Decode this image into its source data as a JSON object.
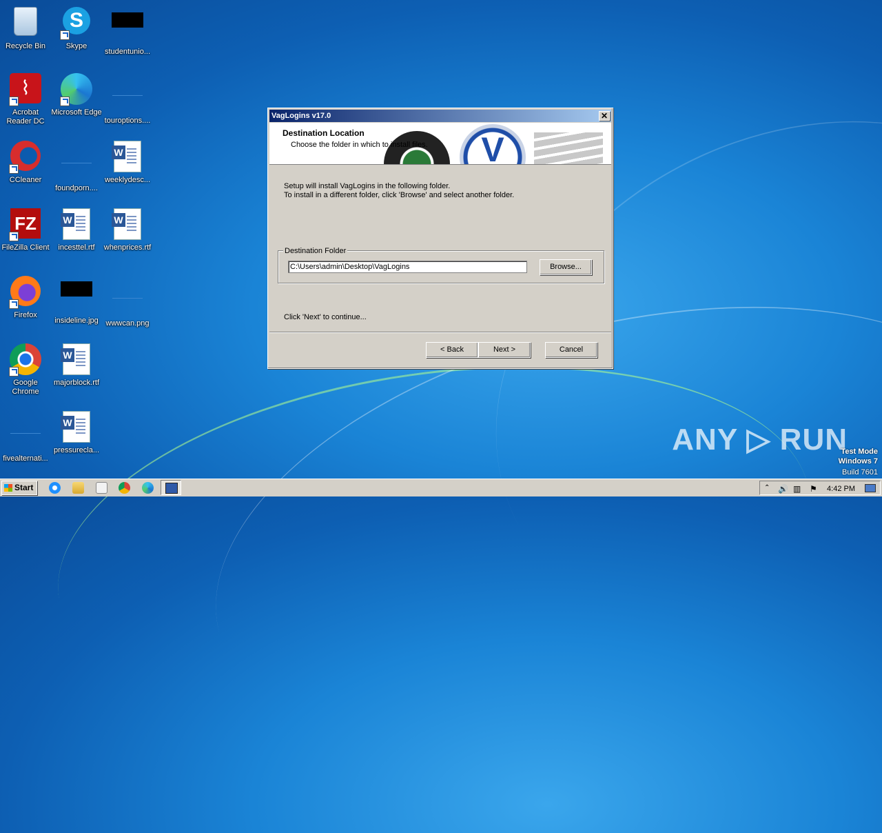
{
  "desktop": {
    "icons": [
      {
        "label": "Recycle Bin"
      },
      {
        "label": "Skype"
      },
      {
        "label": "studentunio..."
      },
      {
        "label": "Acrobat Reader DC"
      },
      {
        "label": "Microsoft Edge"
      },
      {
        "label": "touroptions...."
      },
      {
        "label": "CCleaner"
      },
      {
        "label": "foundporn...."
      },
      {
        "label": "weeklydesc..."
      },
      {
        "label": "FileZilla Client"
      },
      {
        "label": "incesttel.rtf"
      },
      {
        "label": "whenprices.rtf"
      },
      {
        "label": "Firefox"
      },
      {
        "label": "insideline.jpg"
      },
      {
        "label": "wwwcan.png"
      },
      {
        "label": "Google Chrome"
      },
      {
        "label": "majorblock.rtf"
      },
      {
        "label": "fivealternati..."
      },
      {
        "label": "pressurecla..."
      }
    ]
  },
  "dialog": {
    "title": "VagLogins v17.0",
    "close_glyph": "✕",
    "header_title": "Destination Location",
    "header_subtitle": "Choose the folder in which to install files.",
    "intro_line1": "Setup will install VagLogins in the following folder.",
    "intro_line2": "To install in a different folder, click 'Browse' and select another folder.",
    "group_label": "Destination Folder",
    "path_value": "C:\\Users\\admin\\Desktop\\VagLogins",
    "browse_label": "Browse...",
    "continue_text": "Click 'Next' to continue...",
    "back_label": "< Back",
    "next_label": "Next >",
    "cancel_label": "Cancel"
  },
  "taskbar": {
    "start_label": "Start",
    "clock": "4:42 PM"
  },
  "watermark": {
    "text": "ANY ▷ RUN",
    "line1": "Test Mode",
    "line2": "Windows 7",
    "line3": "Build 7601"
  }
}
